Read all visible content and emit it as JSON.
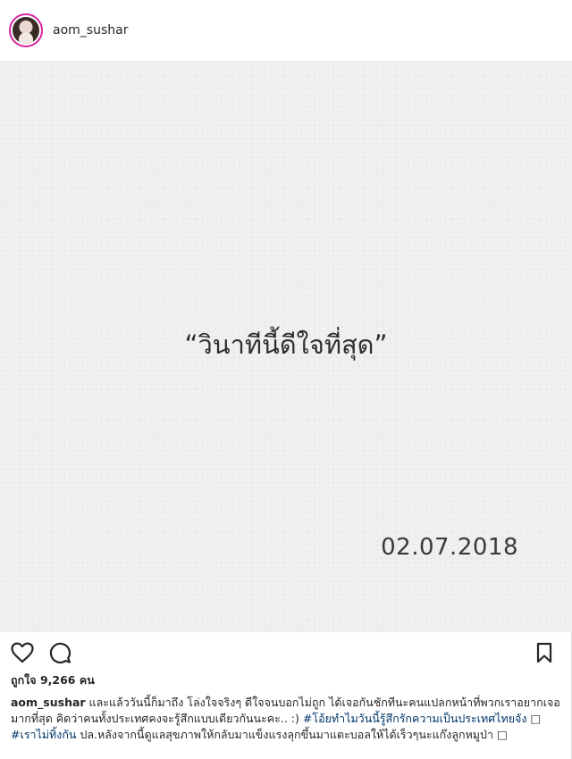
{
  "header": {
    "username": "aom_sushar"
  },
  "photo": {
    "quote": "“วินาทีนี้ดีใจที่สุด”",
    "date": "02.07.2018"
  },
  "actions": {
    "like_icon": "heart-outline-icon",
    "comment_icon": "comment-bubble-icon",
    "save_icon": "bookmark-outline-icon"
  },
  "likes": {
    "label": "ถูกใจ",
    "count": "9,266",
    "unit": "คน"
  },
  "caption": {
    "username": "aom_sushar",
    "text1": " และแล้ววันนี้ก็มาถึง โล่งใจจริงๆ ดีใจจนบอกไม่ถูก ได้เจอกันชักทีนะคนแปลกหน้าที่พวกเราอยากเจอมากที่สุด คิดว่าคนทั้งประเทศคงจะรู้สึกแบบเดียวกันนะคะ.. :) ",
    "tag1": "#โอ้ยทำไมวันนี้รู้สึกรักความเป็นประเทศไทยจัง",
    "text2": " □ ",
    "tag2": "#เราไม่ทิ้งกัน",
    "text3": " ปล.หลังจากนี้ดูแลสุขภาพให้กลับมาแข็งแรงลุกขึ้นมาแตะบอลให้ได้เร็วๆนะแก๊งลูกหมูป่า □"
  }
}
